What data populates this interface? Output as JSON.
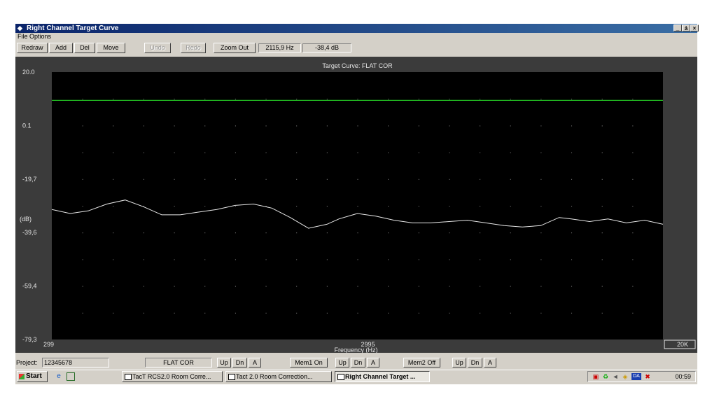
{
  "window": {
    "title": "Right Channel Target Curve",
    "controls": [
      "_",
      "á",
      "×"
    ]
  },
  "menu": [
    "File",
    "Options"
  ],
  "toolbar": {
    "redraw": "Redraw",
    "add": "Add",
    "del": "Del",
    "move": "Move",
    "undo": "Undo",
    "redo": "Redo",
    "zoom_out": "Zoom Out",
    "freq_readout": "2115,9 Hz",
    "db_readout": "-38,4 dB"
  },
  "chart_data": {
    "type": "line",
    "title": "Target Curve: FLAT COR",
    "xlabel": "Frequency (Hz)",
    "ylabel": "(dB)",
    "x_tick_labels": [
      "299",
      "2995"
    ],
    "x_range_end_label": "20K",
    "y_tick_labels": [
      "20.0",
      "0.1",
      "-19,7",
      "-39,6",
      "-59,4",
      "-79,3"
    ],
    "ylim": [
      -79.3,
      20.0
    ],
    "grid": "dotted",
    "series": [
      {
        "color": "#22c022",
        "x_frac": [
          0,
          1
        ],
        "y": [
          9.5,
          9.5
        ]
      },
      {
        "color": "#e8e8e8",
        "x_frac": [
          0,
          0.03,
          0.06,
          0.09,
          0.12,
          0.15,
          0.18,
          0.21,
          0.24,
          0.27,
          0.3,
          0.33,
          0.36,
          0.39,
          0.42,
          0.45,
          0.47,
          0.5,
          0.53,
          0.56,
          0.59,
          0.62,
          0.65,
          0.68,
          0.71,
          0.74,
          0.77,
          0.8,
          0.83,
          0.85,
          0.88,
          0.91,
          0.94,
          0.97,
          1.0
        ],
        "y": [
          -31.0,
          -32.5,
          -31.5,
          -29.0,
          -27.5,
          -30.0,
          -33.0,
          -33.0,
          -32.0,
          -31.0,
          -29.5,
          -29.0,
          -30.5,
          -34.0,
          -38.0,
          -36.5,
          -34.5,
          -32.5,
          -33.5,
          -35.0,
          -36.0,
          -36.0,
          -35.5,
          -35.0,
          -36.0,
          -37.0,
          -37.5,
          -37.0,
          -34.0,
          -34.5,
          -35.5,
          -34.5,
          -36.0,
          -35.0,
          -36.5
        ]
      }
    ]
  },
  "bottom": {
    "project_label": "Project:",
    "project_value": "12345678",
    "curve_name": "FLAT COR",
    "up": "Up",
    "dn": "Dn",
    "a": "A",
    "mem1": "Mem1 On",
    "mem2": "Mem2 Off"
  },
  "taskbar": {
    "start": "Start",
    "tasks": [
      "TacT RCS2.0 Room Corre...",
      "Tact 2.0 Room Correction...",
      "Right Channel Target ..."
    ],
    "tray_da": "DA",
    "clock": "00:59"
  }
}
